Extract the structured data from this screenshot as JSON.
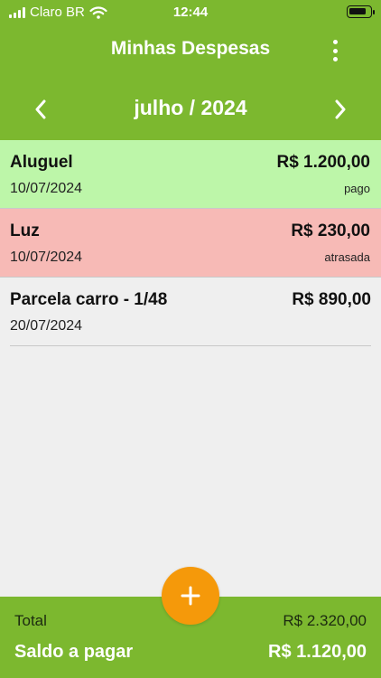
{
  "status_bar": {
    "carrier": "Claro BR",
    "time": "12:44",
    "signal_bars": 4,
    "wifi_icon": "wifi-icon",
    "battery_icon": "battery-icon",
    "battery_level": 0.85
  },
  "header": {
    "title": "Minhas Despesas",
    "menu_icon": "more-vertical-icon",
    "month_label": "julho / 2024",
    "prev_icon": "chevron-left-icon",
    "next_icon": "chevron-right-icon"
  },
  "expenses": [
    {
      "name": "Aluguel",
      "date": "10/07/2024",
      "amount": "R$ 1.200,00",
      "status": "pago",
      "bg": "#bdf6a9"
    },
    {
      "name": "Luz",
      "date": "10/07/2024",
      "amount": "R$ 230,00",
      "status": "atrasada",
      "bg": "#f7bab6"
    },
    {
      "name": "Parcela carro - 1/48",
      "date": "20/07/2024",
      "amount": "R$ 890,00",
      "status": "",
      "bg": "#efefef"
    }
  ],
  "footer": {
    "total_label": "Total",
    "total_value": "R$ 2.320,00",
    "saldo_label": "Saldo a pagar",
    "saldo_value": "R$ 1.120,00"
  },
  "fab": {
    "icon": "plus-icon"
  },
  "colors": {
    "primary": "#7cb82f",
    "accent": "#f5990a",
    "paid_bg": "#bdf6a9",
    "late_bg": "#f7bab6",
    "background": "#efefef"
  }
}
